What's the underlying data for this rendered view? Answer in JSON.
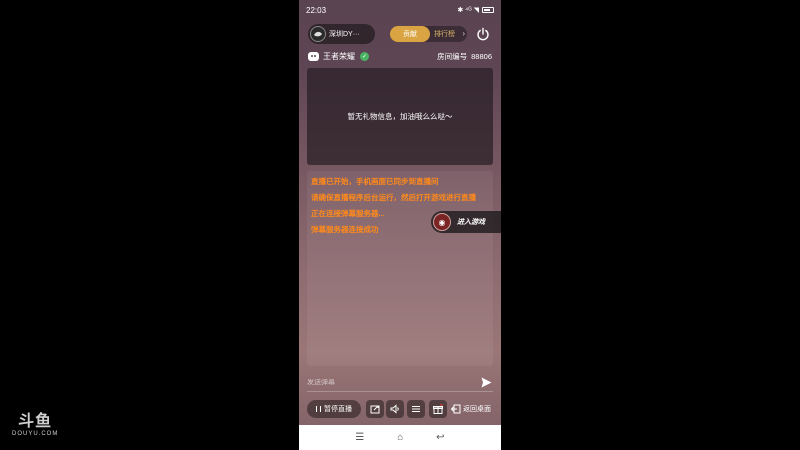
{
  "watermark": {
    "logo": "斗鱼",
    "sub": "DOUYU.COM"
  },
  "status_bar": {
    "time": "22:03",
    "icons": "✱ ⁴ᴳ ◥",
    "battery": ""
  },
  "header": {
    "streamer_name": "深圳DY···",
    "tabs": [
      {
        "label": "贡献"
      },
      {
        "label": "排行榜"
      }
    ]
  },
  "game": {
    "name": "王者荣耀",
    "room_label": "房间编号",
    "room_number": "88806"
  },
  "gift_panel": {
    "empty_text": "暂无礼物信息，加油哦么么哒～"
  },
  "chat": {
    "messages": [
      "直播已开始，手机画面已同步到直播间",
      "请确保直播程序后台运行，然后打开游戏进行直播",
      "正在连接弹幕服务器...",
      "弹幕服务器连接成功"
    ]
  },
  "float_button": {
    "label": "进入游戏"
  },
  "input": {
    "placeholder": "发送弹幕"
  },
  "toolbar": {
    "pause_label": "暂停直播",
    "return_label": "返回桌面"
  },
  "nav": {
    "menu": "☰",
    "home": "⌂",
    "back": "↩"
  },
  "colors": {
    "accent": "#d9a441",
    "system_message": "#ff8a1a"
  }
}
